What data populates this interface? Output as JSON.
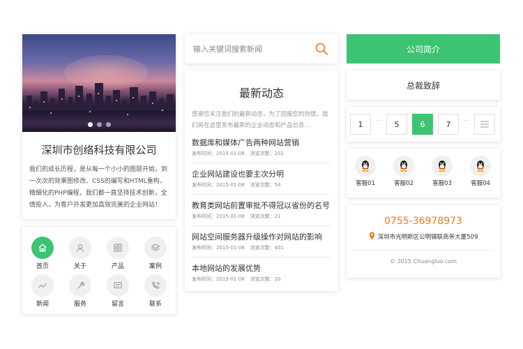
{
  "hero": {
    "company_name": "深圳市创络科技有限公司",
    "description": "我们的成长历程，是从每一个小小的图层开始，到一次次的效果图修改、CSS的编写和HTML重构、精细化的PHP编程，我们都一直坚持技术创新，全情投入，为客户开发更加高效完美的企业网站！",
    "carousel_slides": 3,
    "carousel_active": 0
  },
  "nav": {
    "items": [
      {
        "label": "首页",
        "icon": "home-icon",
        "active": true
      },
      {
        "label": "关于",
        "icon": "user-icon",
        "active": false
      },
      {
        "label": "产品",
        "icon": "grid-icon",
        "active": false
      },
      {
        "label": "案例",
        "icon": "layers-icon",
        "active": false
      },
      {
        "label": "新闻",
        "icon": "chart-line-icon",
        "active": false
      },
      {
        "label": "服务",
        "icon": "wrench-icon",
        "active": false
      },
      {
        "label": "留言",
        "icon": "message-icon",
        "active": false
      },
      {
        "label": "联系",
        "icon": "phone-icon",
        "active": false
      }
    ]
  },
  "search": {
    "placeholder": "输入关键词搜索新闻",
    "icon": "search-icon"
  },
  "news": {
    "title": "最新动态",
    "intro": "感谢您关注我们的最新动态，为了回报您的热情，我们将在这里发布最新的企业动态和产品信息...",
    "items": [
      {
        "title": "数据库和媒体广告两种网站营销",
        "date": "发布时间：2015-01-08",
        "views": "浏览次数：201"
      },
      {
        "title": "企业网站建设也要主次分明",
        "date": "发布时间：2015-01-08",
        "views": "浏览次数：54"
      },
      {
        "title": "教育类网站前置审批不得冠以省份的名号",
        "date": "发布时间：2015-01-08",
        "views": "浏览次数：21"
      },
      {
        "title": "网站空间服务器升级操作对网站的影响",
        "date": "发布时间：2015-01-08",
        "views": "浏览次数：401"
      },
      {
        "title": "本地网站的发展优势",
        "date": "发布时间：2015-01-08",
        "views": "浏览次数：20"
      }
    ]
  },
  "buttons": {
    "intro_label": "公司简介",
    "ceo_label": "总裁致辞"
  },
  "pagination": {
    "pages": [
      "1",
      "5",
      "6",
      "7"
    ],
    "active_page": "6",
    "ellipsis": "···",
    "menu_icon": "list-icon"
  },
  "service": {
    "items": [
      {
        "label": "客服01",
        "icon": "qq-penguin-icon"
      },
      {
        "label": "客服02",
        "icon": "qq-penguin-icon"
      },
      {
        "label": "客服03",
        "icon": "qq-penguin-icon"
      },
      {
        "label": "客服04",
        "icon": "qq-penguin-icon"
      }
    ]
  },
  "contact": {
    "phone": "0755-36978973",
    "address": "深圳市光明新区公明镇联商务大厦509",
    "copyright": "© 2015 Chuangluo.com"
  },
  "colors": {
    "accent": "#3cc473",
    "phone": "#f07a1a",
    "search_icon": "#f07a1a"
  }
}
